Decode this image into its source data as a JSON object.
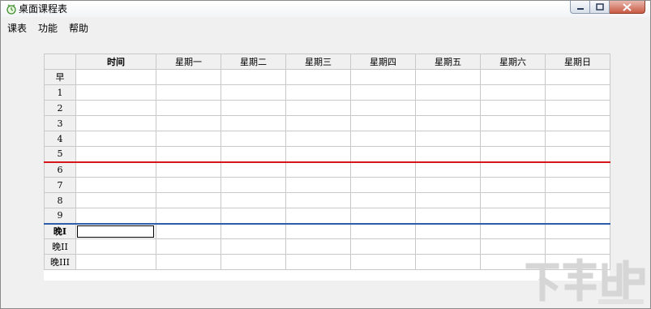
{
  "window": {
    "title": "桌面课程表",
    "icon": "clock-icon"
  },
  "menu": [
    "课表",
    "功能",
    "帮助"
  ],
  "table": {
    "corner": "",
    "time_header": "时间",
    "days": [
      "星期一",
      "星期二",
      "星期三",
      "星期四",
      "星期五",
      "星期六",
      "星期日"
    ],
    "rows": [
      "早",
      "1",
      "2",
      "3",
      "4",
      "5",
      "6",
      "7",
      "8",
      "9",
      "晚I",
      "晚II",
      "晚III"
    ],
    "bold_rows": [
      "晚I"
    ],
    "focused_row": "晚I",
    "separator_colors": {
      "afternoon": "#d9151c",
      "evening": "#2f5ea8"
    }
  },
  "watermark": {
    "text": "下载吧"
  }
}
